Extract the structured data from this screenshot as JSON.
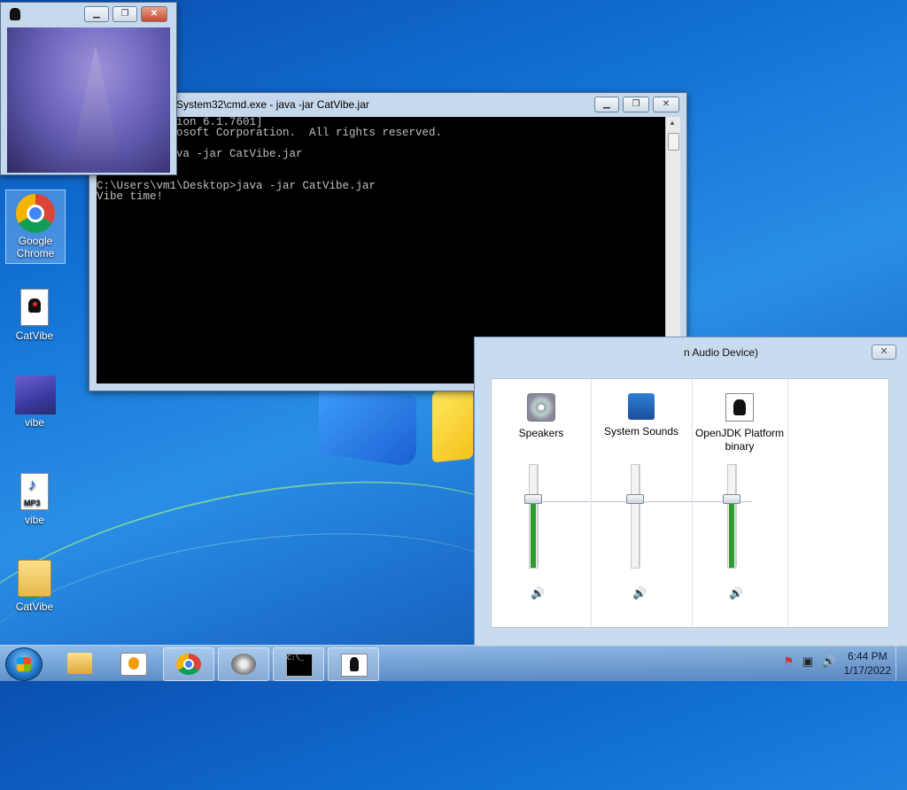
{
  "desktop": {
    "icons": [
      {
        "label_line1": "Google",
        "label_line2": "Chrome"
      },
      {
        "label_line1": "CatVibe",
        "label_line2": ""
      },
      {
        "label_line1": "vibe",
        "label_line2": ""
      },
      {
        "label_line1": "vibe",
        "label_line2": ""
      },
      {
        "label_line1": "CatVibe",
        "label_line2": ""
      }
    ],
    "mp3_badge": "MP3"
  },
  "cmd_window": {
    "title": "System32\\cmd.exe - java  -jar CatVibe.jar",
    "lines": [
      "indows [Version 6.1.7601]",
      "c) 2009 Microsoft Corporation.  All rights reserved.",
      "",
      "1\\Desktop>java -jar CatVibe.jar",
      "",
      "",
      "C:\\Users\\vm1\\Desktop>java -jar CatVibe.jar",
      "Vibe time!"
    ]
  },
  "mixer_window": {
    "title": "n Audio Device)",
    "channels": [
      {
        "label": "Speakers",
        "level": 0.67,
        "icon": "speaker-icon"
      },
      {
        "label": "System Sounds",
        "level": 0.67,
        "icon": "system-sounds-icon"
      },
      {
        "label": "OpenJDK Platform binary",
        "level": 0.67,
        "icon": "java-icon"
      }
    ]
  },
  "taskbar": {
    "cmd_glyph": "C:\\_",
    "clock_time": "6:44 PM",
    "clock_date": "1/17/2022"
  }
}
